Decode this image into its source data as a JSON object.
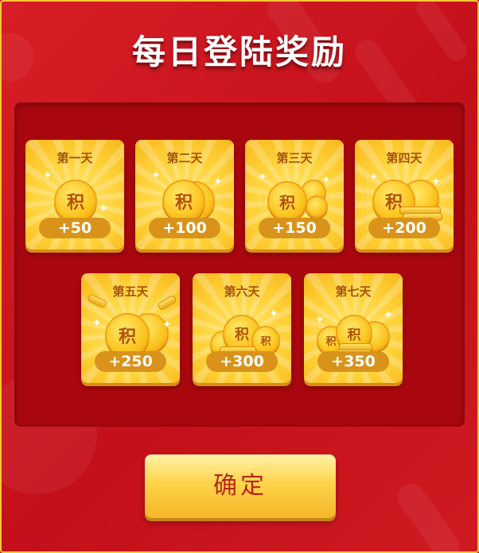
{
  "dialog": {
    "title": "每日登陆奖励",
    "confirm_label": "确定",
    "coin_char": "积",
    "days": [
      {
        "label": "第一天",
        "points": "+50"
      },
      {
        "label": "第二天",
        "points": "+100"
      },
      {
        "label": "第三天",
        "points": "+150"
      },
      {
        "label": "第四天",
        "points": "+200"
      },
      {
        "label": "第五天",
        "points": "+250"
      },
      {
        "label": "第六天",
        "points": "+300"
      },
      {
        "label": "第七天",
        "points": "+350"
      }
    ]
  },
  "colors": {
    "background": "#c8141d",
    "panel": "#a8070e",
    "card": "#ffd23a",
    "accent": "#f7c636",
    "button_text": "#b7281a"
  }
}
